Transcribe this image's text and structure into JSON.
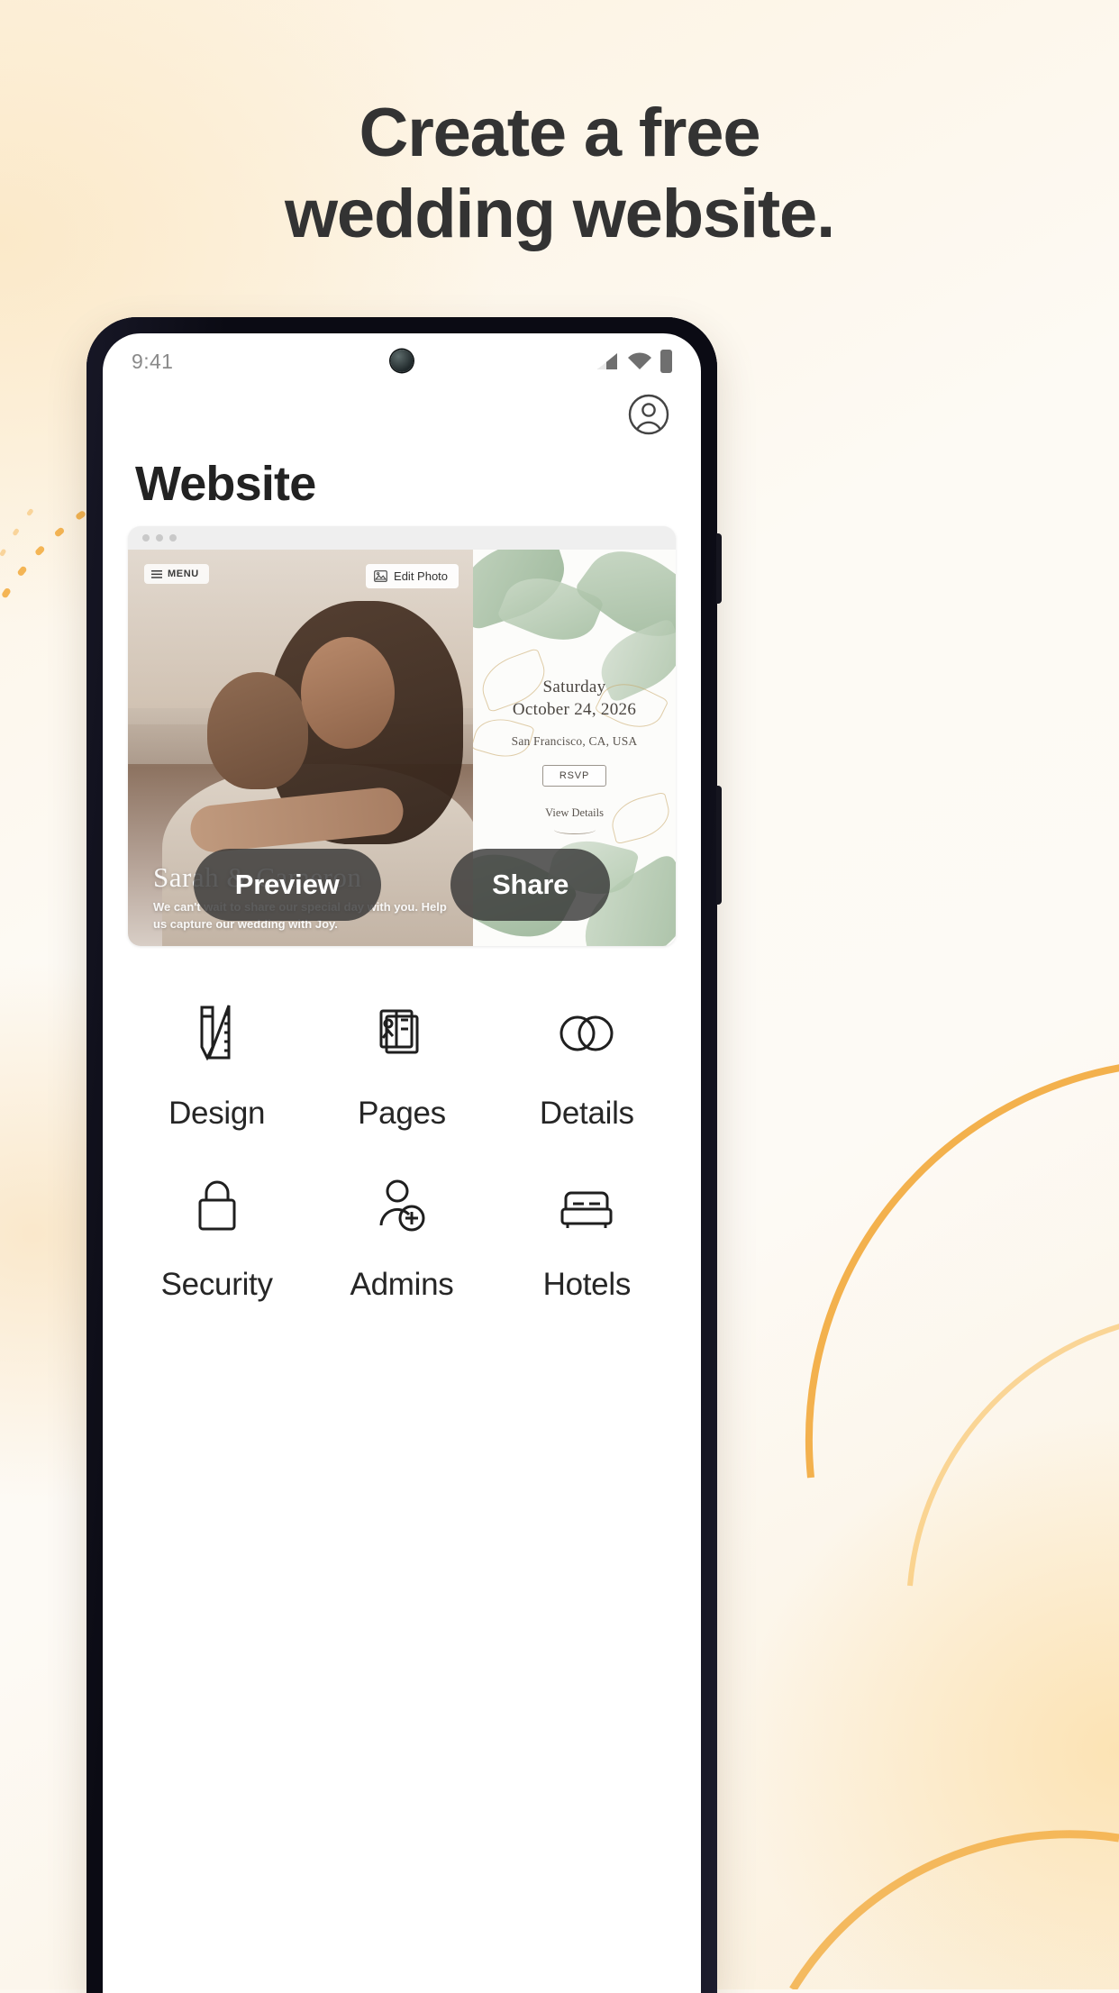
{
  "headline": {
    "line1": "Create a free",
    "line2": "wedding website."
  },
  "colors": {
    "background": "#fdf8f0",
    "accent_gold": "#f5a623",
    "heading": "#333333",
    "button": "#343434"
  },
  "phone": {
    "status_bar": {
      "time": "9:41",
      "icons": [
        "signal-icon",
        "wifi-icon",
        "battery-icon"
      ]
    },
    "header": {
      "account_icon": "account-circle-icon"
    },
    "page_title": "Website",
    "preview_card": {
      "browser_dots": 3,
      "menu_chip": "MENU",
      "edit_photo_chip": "Edit Photo",
      "hero": {
        "couple_names": "Sarah & Cameron",
        "subtitle": "We can't wait to share our special day with you. Help us capture our wedding with Joy."
      },
      "invitation": {
        "day": "Saturday",
        "date": "October 24, 2026",
        "location": "San Francisco, CA, USA",
        "rsvp_label": "RSVP",
        "view_details_label": "View Details"
      },
      "actions": {
        "preview_label": "Preview",
        "share_label": "Share"
      }
    },
    "grid": [
      {
        "label": "Design",
        "icon": "pencil-ruler-icon"
      },
      {
        "label": "Pages",
        "icon": "pages-stack-icon"
      },
      {
        "label": "Details",
        "icon": "interlocking-rings-icon"
      },
      {
        "label": "Security",
        "icon": "lock-icon"
      },
      {
        "label": "Admins",
        "icon": "add-person-icon"
      },
      {
        "label": "Hotels",
        "icon": "bed-icon"
      }
    ]
  }
}
